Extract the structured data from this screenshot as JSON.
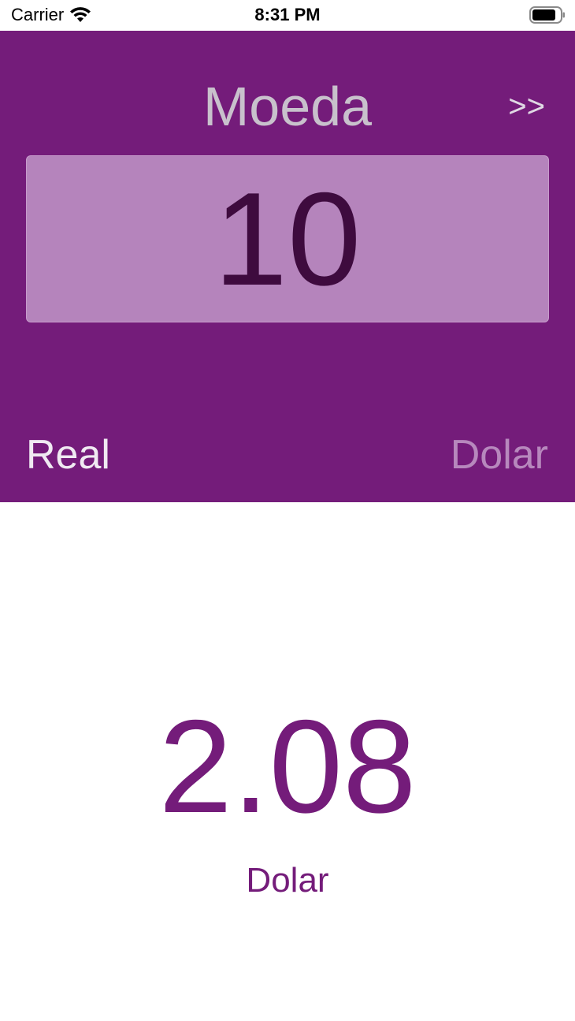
{
  "status_bar": {
    "carrier": "Carrier",
    "time": "8:31 PM",
    "wifi_icon": "wifi-icon",
    "battery_icon": "battery-icon"
  },
  "header": {
    "title": "Moeda",
    "next_label": ">>",
    "amount": "10",
    "from_currency": "Real",
    "to_currency": "Dolar"
  },
  "result": {
    "value": "2.08",
    "currency": "Dolar"
  },
  "colors": {
    "brand_purple": "#741c7a",
    "amount_box": "#b584bc",
    "amount_text": "#3e0b3e",
    "title_text": "#c8c1cc"
  }
}
